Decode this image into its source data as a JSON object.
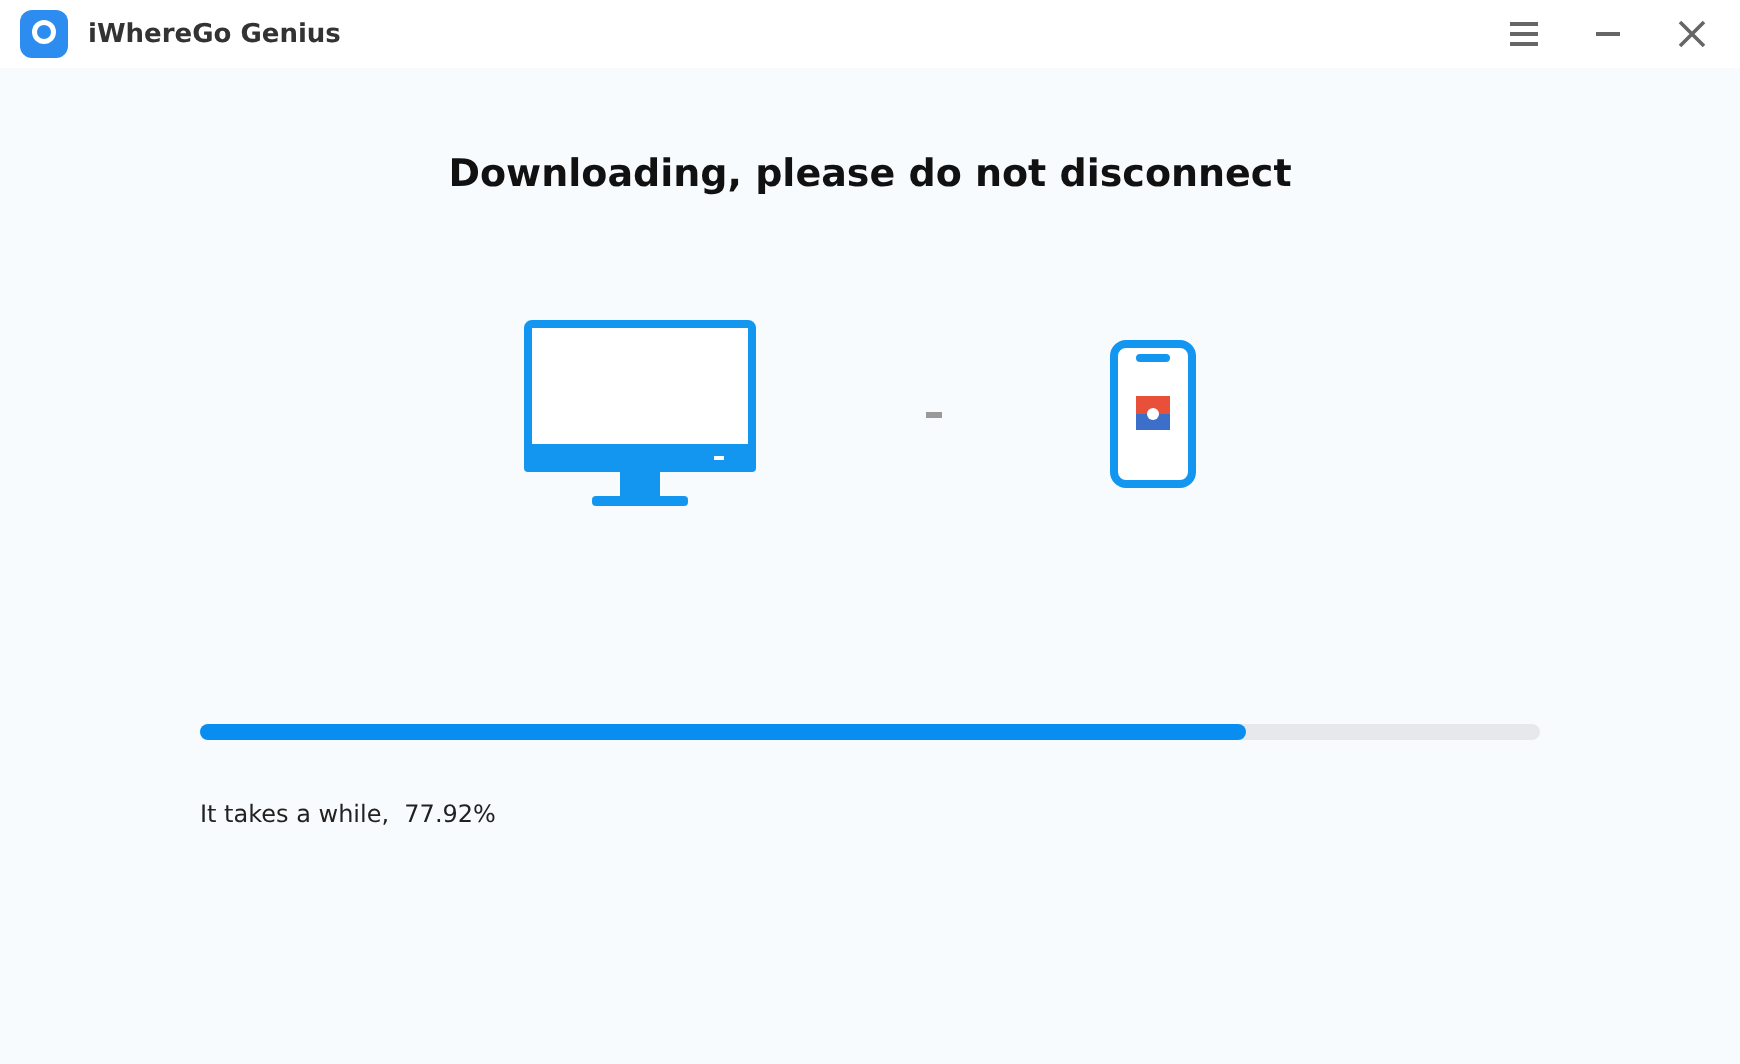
{
  "window": {
    "title": "iWhereGo Genius"
  },
  "heading": "Downloading, please do not disconnect",
  "progress": {
    "level": 0.78,
    "status": "It takes a while,  77.92%"
  }
}
